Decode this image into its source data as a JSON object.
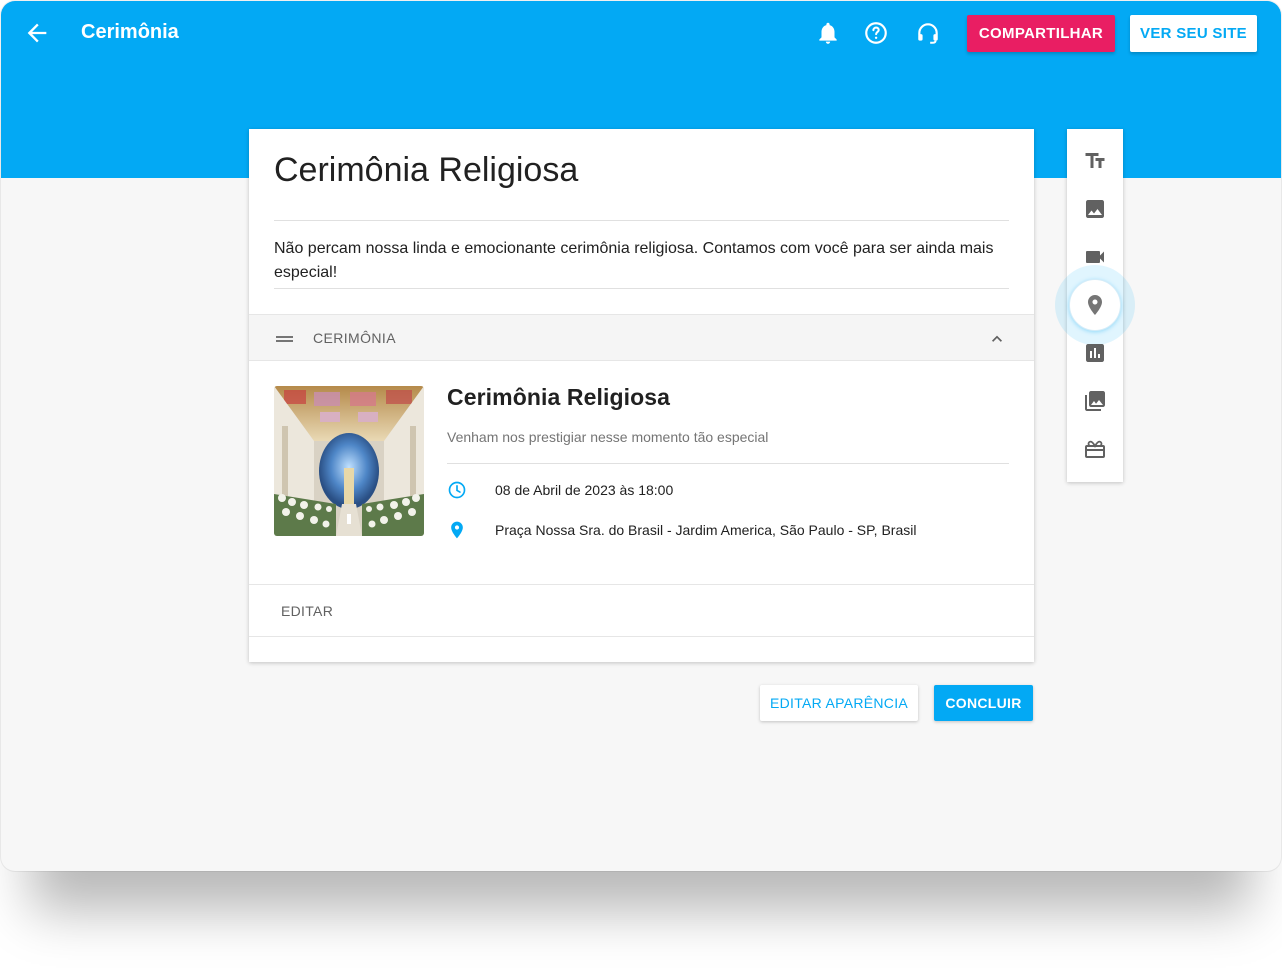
{
  "header": {
    "title": "Cerimônia",
    "share_label": "COMPARTILHAR",
    "view_site_label": "VER SEU SITE"
  },
  "page": {
    "heading": "Cerimônia Religiosa",
    "intro": "Não percam nossa linda e emocionante cerimônia religiosa. Contamos com você para ser ainda mais especial!"
  },
  "section": {
    "label": "CERIMÔNIA",
    "event_title": "Cerimônia Religiosa",
    "event_subtitle": "Venham nos prestigiar nesse momento tão especial",
    "datetime": "08 de Abril de 2023 às 18:00",
    "location": "Praça Nossa Sra. do Brasil - Jardim America, São Paulo - SP, Brasil",
    "edit_label": "EDITAR"
  },
  "toolbox": {
    "tools": [
      "text-icon",
      "image-icon",
      "video-icon",
      "location-pin-icon",
      "chart-icon",
      "gallery-icon",
      "gift-icon"
    ],
    "active": "location-pin-icon"
  },
  "actions": {
    "appearance_label": "EDITAR APARÊNCIA",
    "done_label": "CONCLUIR"
  },
  "colors": {
    "primary": "#03a9f4",
    "accent": "#e91e63"
  }
}
